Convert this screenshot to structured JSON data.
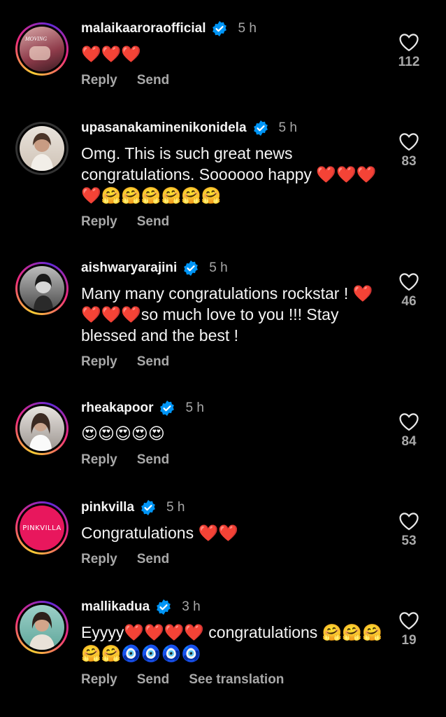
{
  "labels": {
    "reply": "Reply",
    "send": "Send",
    "see_translation": "See translation"
  },
  "comments": [
    {
      "username": "malaikaaroraofficial",
      "time": "5 h",
      "text": "❤️❤️❤️",
      "likes": "112",
      "avatar_icon": "magazine-cover-avatar"
    },
    {
      "username": "upasanakaminenikonidela",
      "time": "5 h",
      "text": "Omg. This is such great news congratulations. Soooooo happy ❤️❤️❤️❤️🤗🤗🤗🤗🤗🤗",
      "likes": "83",
      "avatar_icon": "portrait-avatar"
    },
    {
      "username": "aishwaryarajini",
      "time": "5 h",
      "text": "Many many congratulations rockstar ! ❤️❤️❤️❤️so much love to you !!! Stay blessed and the best !",
      "likes": "46",
      "avatar_icon": "bw-portrait-avatar"
    },
    {
      "username": "rheakapoor",
      "time": "5 h",
      "text": "😍😍😍😍😍",
      "likes": "84",
      "avatar_icon": "portrait-avatar"
    },
    {
      "username": "pinkvilla",
      "time": "5 h",
      "text": "Congratulations ❤️❤️",
      "likes": "53",
      "avatar_text": "PINKVILLA"
    },
    {
      "username": "mallikadua",
      "time": "3 h",
      "text": "Eyyyy❤️❤️❤️❤️ congratulations 🤗🤗🤗🤗🤗🧿🧿🧿🧿",
      "likes": "19",
      "avatar_icon": "portrait-avatar"
    }
  ],
  "colors": {
    "background": "#000000",
    "text": "#f5f5f5",
    "secondary": "#a8a8a8",
    "verified": "#0095f6",
    "pinkvilla": "#e8175d"
  }
}
